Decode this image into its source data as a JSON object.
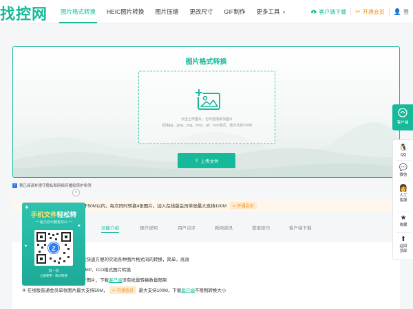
{
  "header": {
    "logo": "找控网",
    "nav": [
      {
        "label": "图片格式转换"
      },
      {
        "label": "HEIC图片转换"
      },
      {
        "label": "图片压缩"
      },
      {
        "label": "更改尺寸"
      },
      {
        "label": "GIF制作"
      },
      {
        "label": "更多工具"
      }
    ],
    "download_label": "客户端下载",
    "vip_label": "开通会员",
    "login_label": "登"
  },
  "upload": {
    "title": "图片格式转换",
    "hint": "点击上传图片，也可拖拽添加图片",
    "types": "支持jpg、jpeg、png、bmp、gif、heic格式，最大支持100M",
    "button_label": "上传文件"
  },
  "agreement": "我已阅读并遵守隐私和网络传播权保护条例",
  "notice": {
    "text": "于50M以内，每次同时转换4张图片。加入在线版会员单张最大支持100M",
    "pill": "开通会员"
  },
  "tabs": [
    {
      "label": "功能介绍"
    },
    {
      "label": "操作说明"
    },
    {
      "label": "用户点评"
    },
    {
      "label": "新闻资讯"
    },
    {
      "label": "使用技巧"
    },
    {
      "label": "客户端下载"
    }
  ],
  "content": {
    "line1": "以快速方便的实现各种图片格式间的转换，简单，高效",
    "line2": "BMP、ICO格式图片转换",
    "line3_prefix": "个图片，下载",
    "line3_link": "客户端",
    "line3_suffix": "没有批量转换数量限制",
    "line4_prefix": "④ 在线版普通会员单张图片最大支持50M，",
    "line4_pill": "开通会员",
    "line4_mid": "最大支持100M，下载",
    "line4_link": "客户端",
    "line4_suffix": "不限制转换大小"
  },
  "popup": {
    "title_highlight": "手机文件",
    "title_rest": "轻松转",
    "subtitle": "一 给力办公服务办公 一",
    "scan": "扫一扫",
    "scan_sub": "立即使用 · 格式转换",
    "close": "×"
  },
  "sidebar": {
    "client_label": "客户端",
    "items": [
      {
        "label": "QQ"
      },
      {
        "label": "微信"
      },
      {
        "label": "人工客服"
      },
      {
        "label": "收藏"
      },
      {
        "label": "返回顶部"
      }
    ]
  },
  "colors": {
    "accent": "#16b99a",
    "vip": "#f29322"
  }
}
